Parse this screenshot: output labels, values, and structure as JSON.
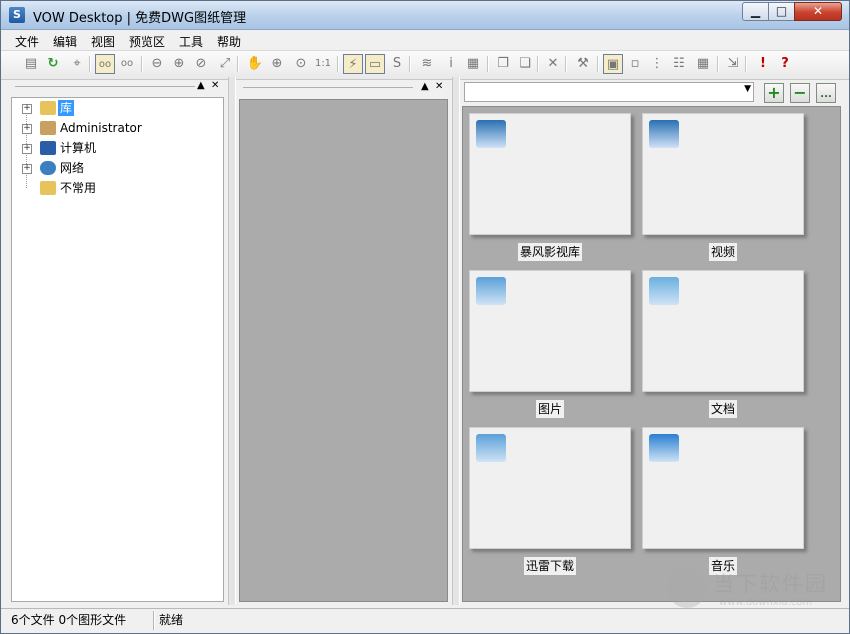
{
  "window": {
    "title": "VOW Desktop | 免费DWG图纸管理",
    "app_icon_glyph": "S",
    "min_glyph": "▁",
    "max_glyph": "□",
    "close_glyph": "✕"
  },
  "menu": {
    "items": [
      "文件",
      "编辑",
      "视图",
      "预览区",
      "工具",
      "帮助"
    ]
  },
  "toolbar": {
    "buttons": [
      {
        "name": "open-folder-icon",
        "glyph": "▤"
      },
      {
        "name": "refresh-icon",
        "glyph": "↻",
        "color": "#2b9a2b"
      },
      {
        "name": "find-icon",
        "glyph": "⌖"
      },
      {
        "name": "view-oo-icon",
        "glyph": "oo",
        "active": true
      },
      {
        "name": "view-oo-alt-icon",
        "glyph": "oo"
      },
      {
        "name": "zoom-out-icon",
        "glyph": "⊖"
      },
      {
        "name": "zoom-in-icon",
        "glyph": "⊕"
      },
      {
        "name": "zoom-window-icon",
        "glyph": "⊘"
      },
      {
        "name": "zoom-extents-icon",
        "glyph": "⤢"
      },
      {
        "name": "pan-icon",
        "glyph": "✋"
      },
      {
        "name": "zoom-realtime-icon",
        "glyph": "⊕"
      },
      {
        "name": "zoom-previous-icon",
        "glyph": "⊙"
      },
      {
        "name": "zoom-1to1-icon",
        "glyph": "1:1"
      },
      {
        "name": "lightning-icon",
        "glyph": "⚡",
        "active": true
      },
      {
        "name": "measure-icon",
        "glyph": "▭",
        "active": true
      },
      {
        "name": "text-s-icon",
        "glyph": "S"
      },
      {
        "name": "layers-icon",
        "glyph": "≋"
      },
      {
        "name": "info-icon",
        "glyph": "i"
      },
      {
        "name": "print-icon",
        "glyph": "▦"
      },
      {
        "name": "copy-icon",
        "glyph": "❐"
      },
      {
        "name": "paste-icon",
        "glyph": "❏"
      },
      {
        "name": "delete-icon",
        "glyph": "✕"
      },
      {
        "name": "tools-icon",
        "glyph": "⚒"
      },
      {
        "name": "view-large-icons-icon",
        "glyph": "▣",
        "active": true
      },
      {
        "name": "view-small-icons-icon",
        "glyph": "▫"
      },
      {
        "name": "view-list-icon",
        "glyph": "⋮"
      },
      {
        "name": "view-details-icon",
        "glyph": "☷"
      },
      {
        "name": "view-grid-icon",
        "glyph": "▦"
      },
      {
        "name": "export-icon",
        "glyph": "⇲"
      },
      {
        "name": "exclamation-icon",
        "glyph": "!",
        "color": "#c00000"
      },
      {
        "name": "help-icon",
        "glyph": "?",
        "color": "#c00000"
      }
    ]
  },
  "tree": {
    "pin_glyph": "▲",
    "close_glyph": "✕",
    "items": [
      {
        "label": "库",
        "icon_color": "#e8c25a",
        "selected": true
      },
      {
        "label": "Administrator",
        "icon_color": "#c8a060"
      },
      {
        "label": "计算机",
        "icon_color": "#2a5ca8"
      },
      {
        "label": "网络",
        "icon_color": "#3b7fc0"
      },
      {
        "label": "不常用",
        "icon_color": "#e8c25a"
      }
    ]
  },
  "middle_pane": {
    "pin_glyph": "▲",
    "close_glyph": "✕"
  },
  "right_pane": {
    "path_value": "",
    "dropdown_glyph": "▼",
    "add_glyph": "+",
    "remove_glyph": "−",
    "more_glyph": "..."
  },
  "tiles": [
    {
      "label": "暴风影视库",
      "icon": "video-library-icon",
      "icon_color": "#2a6fb3"
    },
    {
      "label": "视频",
      "icon": "video-icon",
      "icon_color": "#2a6fb3"
    },
    {
      "label": "图片",
      "icon": "picture-icon",
      "icon_color": "#5aa0d8"
    },
    {
      "label": "文档",
      "icon": "document-icon",
      "icon_color": "#6ab0e0"
    },
    {
      "label": "迅雷下载",
      "icon": "download-icon",
      "icon_color": "#5aa0d8"
    },
    {
      "label": "音乐",
      "icon": "music-icon",
      "icon_color": "#2a7fd0"
    }
  ],
  "status": {
    "files": "6个文件 0个图形文件",
    "state": "就绪"
  },
  "watermark": {
    "text": "当下软件园",
    "url": "www.downxia.com"
  },
  "colors": {
    "selection": "#3399ff",
    "tile_bg": "#f0f0f0",
    "pane_bg": "#ababab"
  }
}
